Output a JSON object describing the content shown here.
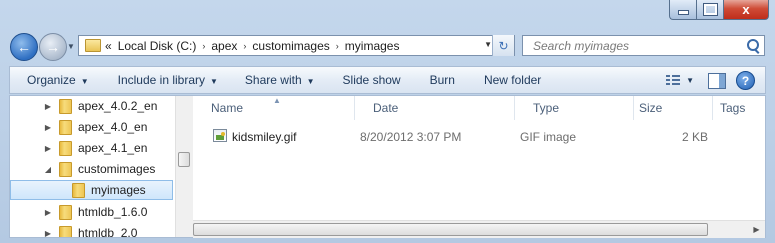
{
  "window": {
    "controls": {
      "minimize": "",
      "maximize": "",
      "close": "x"
    }
  },
  "nav": {
    "back_icon": "back-arrow-icon",
    "forward_icon": "forward-arrow-icon"
  },
  "address": {
    "overflow": "«",
    "path": [
      "Local Disk (C:)",
      "apex",
      "customimages",
      "myimages"
    ],
    "separator": "›"
  },
  "search": {
    "placeholder": "Search myimages"
  },
  "toolbar": {
    "organize": "Organize",
    "include_in_library": "Include in library",
    "share_with": "Share with",
    "slide_show": "Slide show",
    "burn": "Burn",
    "new_folder": "New folder",
    "help": "?"
  },
  "tree": [
    {
      "label": "apex_4.0.2_en",
      "expanded": false,
      "selected": false
    },
    {
      "label": "apex_4.0_en",
      "expanded": false,
      "selected": false
    },
    {
      "label": "apex_4.1_en",
      "expanded": false,
      "selected": false
    },
    {
      "label": "customimages",
      "expanded": true,
      "selected": false
    },
    {
      "label": "myimages",
      "expanded": false,
      "selected": true
    },
    {
      "label": "htmldb_1.6.0",
      "expanded": false,
      "selected": false
    },
    {
      "label": "htmldb_2.0",
      "expanded": false,
      "selected": false
    }
  ],
  "columns": {
    "name": "Name",
    "date": "Date",
    "type": "Type",
    "size": "Size",
    "tags": "Tags"
  },
  "files": [
    {
      "name": "kidsmiley.gif",
      "date": "8/20/2012 3:07 PM",
      "type": "GIF image",
      "size": "2 KB",
      "tags": ""
    }
  ],
  "colors": {
    "accent": "#3a6aa8",
    "selection": "#cfe6fb",
    "toolbar_text": "#1e395b"
  }
}
